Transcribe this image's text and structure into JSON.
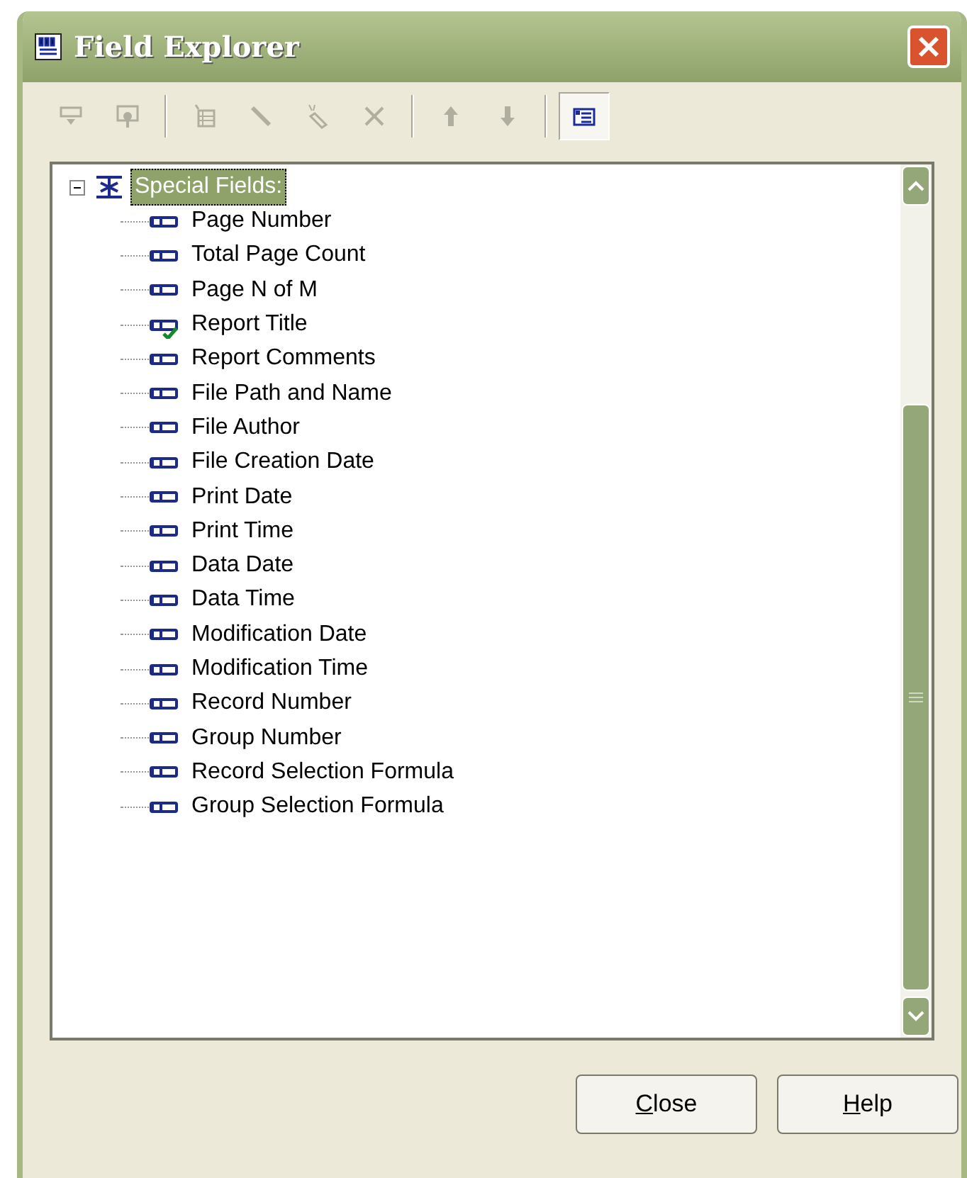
{
  "window": {
    "title": "Field Explorer"
  },
  "toolbar": {
    "groups": [
      [
        {
          "disabled": true,
          "selected": false
        },
        {
          "disabled": true,
          "selected": false
        }
      ],
      [
        {
          "disabled": true,
          "selected": false
        },
        {
          "disabled": true,
          "selected": false
        },
        {
          "disabled": true,
          "selected": false
        },
        {
          "disabled": true,
          "selected": false
        }
      ],
      [
        {
          "disabled": true,
          "selected": false
        },
        {
          "disabled": true,
          "selected": false
        }
      ],
      [
        {
          "disabled": false,
          "selected": true
        }
      ]
    ]
  },
  "tree": {
    "root": {
      "label": "Special Fields:",
      "selected": true,
      "expanded": true,
      "children": [
        {
          "label": "Page Number",
          "in_use": false
        },
        {
          "label": "Total Page Count",
          "in_use": false
        },
        {
          "label": "Page N of M",
          "in_use": false
        },
        {
          "label": "Report Title",
          "in_use": true
        },
        {
          "label": "Report Comments",
          "in_use": false
        },
        {
          "label": "File Path and Name",
          "in_use": false
        },
        {
          "label": "File Author",
          "in_use": false
        },
        {
          "label": "File Creation Date",
          "in_use": false
        },
        {
          "label": "Print Date",
          "in_use": false
        },
        {
          "label": "Print Time",
          "in_use": false
        },
        {
          "label": "Data Date",
          "in_use": false
        },
        {
          "label": "Data Time",
          "in_use": false
        },
        {
          "label": "Modification Date",
          "in_use": false
        },
        {
          "label": "Modification Time",
          "in_use": false
        },
        {
          "label": "Record Number",
          "in_use": false
        },
        {
          "label": "Group Number",
          "in_use": false
        },
        {
          "label": "Record Selection Formula",
          "in_use": false
        },
        {
          "label": "Group Selection Formula",
          "in_use": false
        }
      ]
    }
  },
  "buttons": [
    {
      "label": "Close"
    },
    {
      "label": "Help"
    }
  ]
}
